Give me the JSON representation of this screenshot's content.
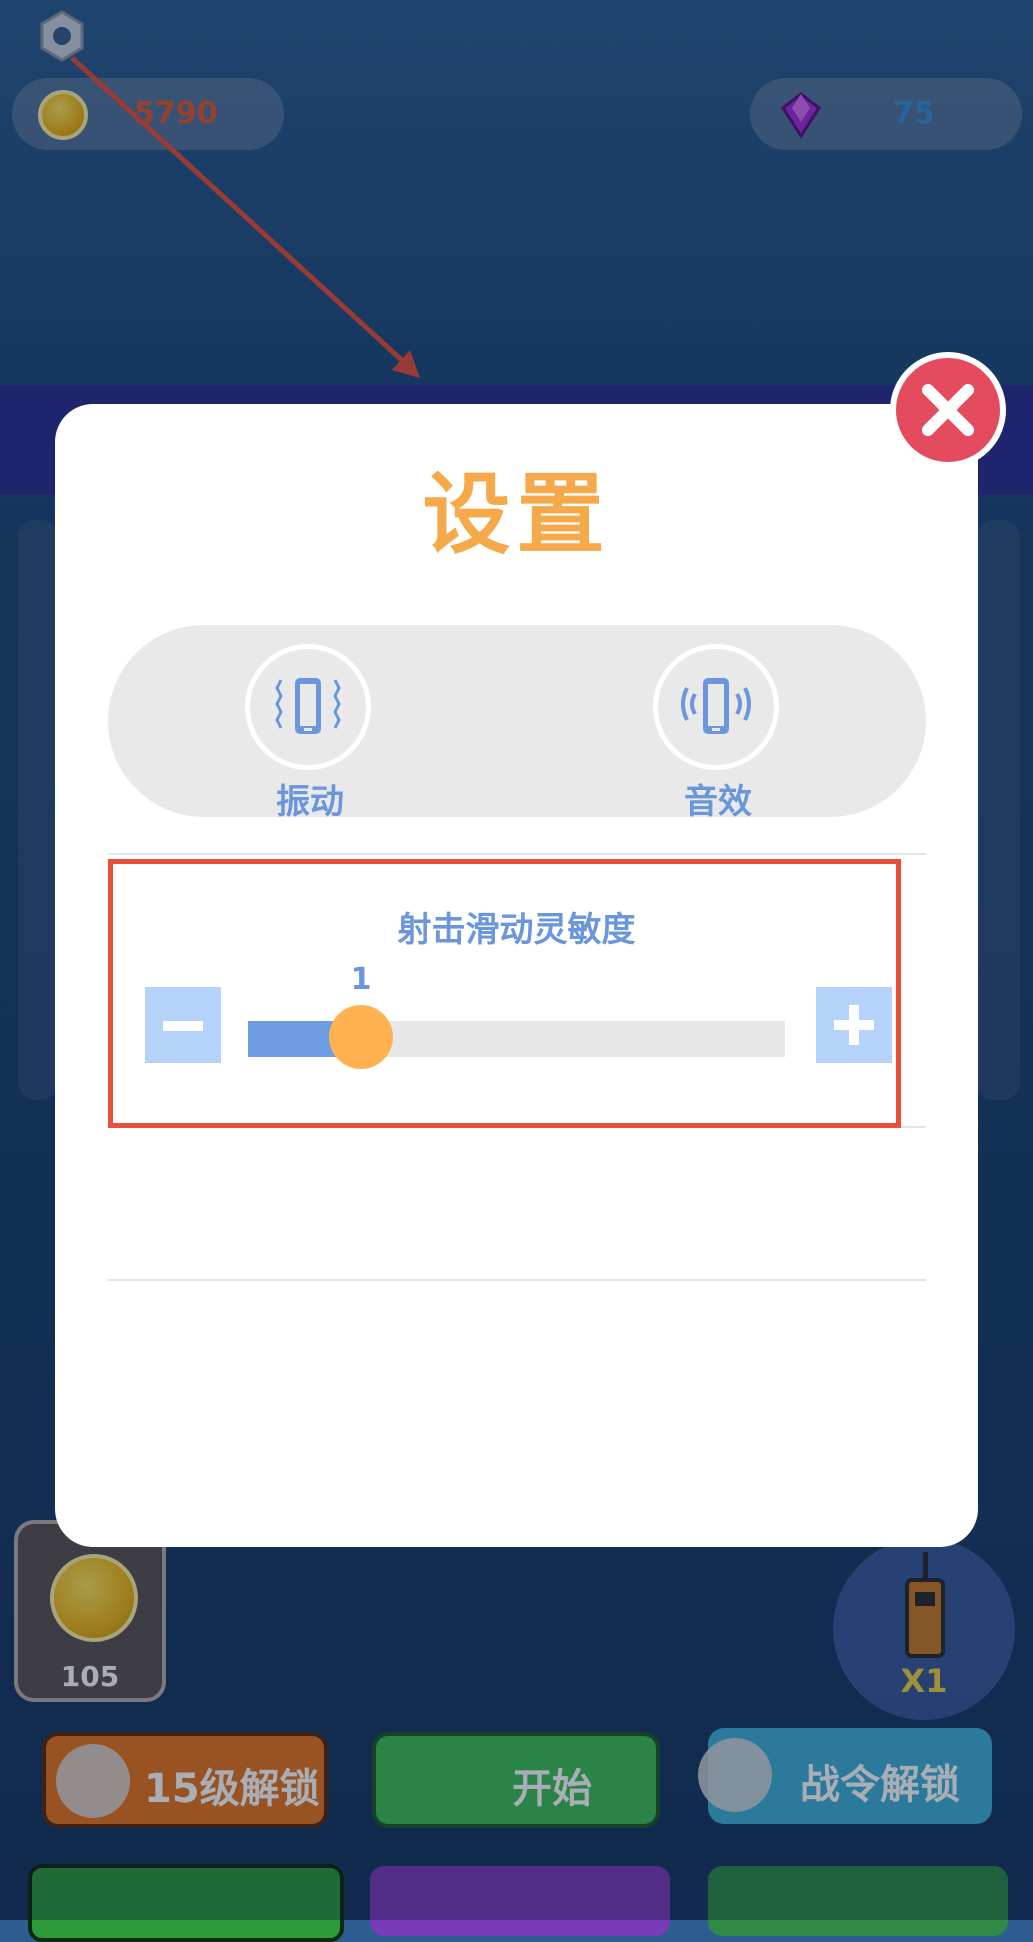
{
  "top": {
    "coins": "5790",
    "gems": "75"
  },
  "settings": {
    "title": "设置",
    "vibration_label": "振动",
    "sound_label": "音效",
    "sensitivity_title": "射击滑动灵敏度",
    "sensitivity_value": "1",
    "sensitivity_fraction": 0.21
  },
  "bottom": {
    "coin_reward": "105",
    "radio_count": "X1",
    "level_unlock": "15级解锁",
    "start": "开始",
    "pass_unlock": "战令解锁"
  },
  "colors": {
    "accent_orange": "#f6a94a",
    "accent_blue": "#6b96db",
    "close_red": "#e54b5e",
    "highlight_red": "#e8503a"
  }
}
